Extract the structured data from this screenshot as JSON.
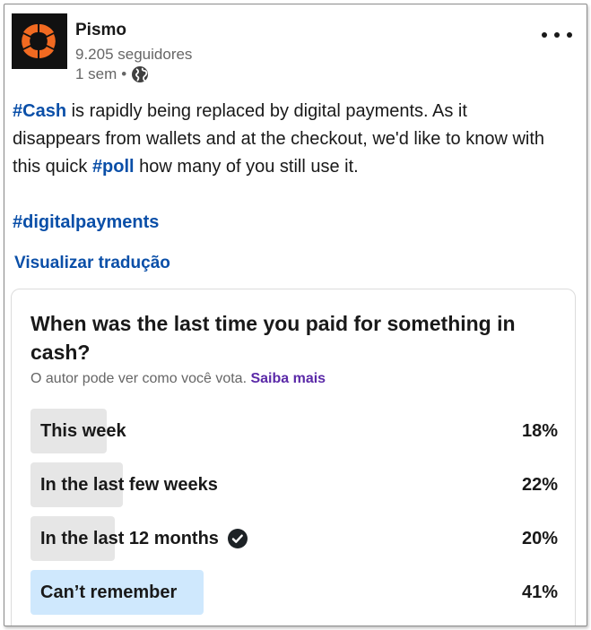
{
  "author": {
    "name": "Pismo",
    "followers": "9.205 seguidores",
    "time": "1 sem",
    "separator": "•",
    "visibility_icon": "globe-icon",
    "logo_icon": "pismo-logo",
    "brand_color": "#f26a21"
  },
  "post": {
    "hashtag_cash": "#Cash",
    "text_1": " is rapidly being replaced by digital payments. As it disappears from wallets and at the checkout, we'd like to know with this quick ",
    "hashtag_poll": "#poll",
    "text_2": " how many of you still use it.",
    "hashtag_digital": "#digitalpayments",
    "translate_label": "Visualizar tradução"
  },
  "poll": {
    "question": "When was the last time you paid for something in cash?",
    "note": "O autor pode ver como você vota.",
    "learn_more": "Saiba mais",
    "options": [
      {
        "label": "This week",
        "percent_label": "18%",
        "percent": 18,
        "selected": false
      },
      {
        "label": "In the last few weeks",
        "percent_label": "22%",
        "percent": 22,
        "selected": false
      },
      {
        "label": "In the last 12 months",
        "percent_label": "20%",
        "percent": 20,
        "selected": false,
        "voted": true
      },
      {
        "label": "Can’t remember",
        "percent_label": "41%",
        "percent": 41,
        "selected": true
      }
    ],
    "bar_color": "#e6e6e6",
    "leading_bar_color": "#cfe8fd",
    "check_color": "#1d2226"
  },
  "colors": {
    "link": "#0a4fa8",
    "learn_more": "#5b2aa8",
    "muted": "#666666"
  }
}
